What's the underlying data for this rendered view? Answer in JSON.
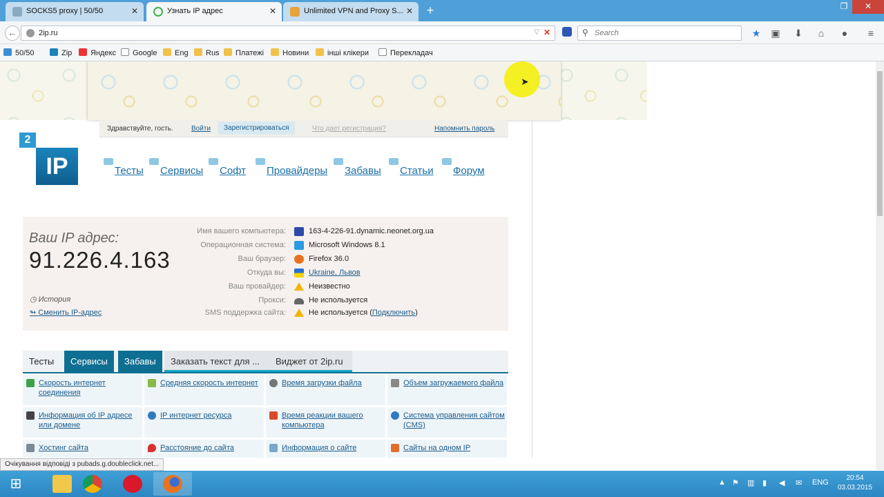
{
  "browser": {
    "tabs": [
      {
        "label": "SOCKS5 proxy | 50/50",
        "active": false
      },
      {
        "label": "Узнать IP адрес",
        "active": true
      },
      {
        "label": "Unlimited VPN and Proxy S...",
        "active": false
      }
    ],
    "new_tab": "+",
    "url": "2ip.ru",
    "search_placeholder": "Search",
    "window_controls": {
      "restore": "❐",
      "close": "✕"
    }
  },
  "bookmarks": [
    {
      "label": "50/50",
      "icon": "page-icon"
    },
    {
      "label": "Zip",
      "icon": "zip-icon"
    },
    {
      "label": "Яндекс",
      "icon": "yandex-icon"
    },
    {
      "label": "Google",
      "icon": "page-icon"
    },
    {
      "label": "Eng",
      "icon": "folder-icon"
    },
    {
      "label": "Rus",
      "icon": "folder-icon"
    },
    {
      "label": "Платежі",
      "icon": "folder-icon"
    },
    {
      "label": "Новини",
      "icon": "folder-icon"
    },
    {
      "label": "інші клікери",
      "icon": "folder-icon"
    },
    {
      "label": "Перекладач",
      "icon": "page-icon"
    }
  ],
  "site": {
    "login_bar": {
      "greeting": "Здравствуйте, гость.",
      "login": "Войти",
      "register": "Зарегистрироваться",
      "why_register": "Что дает регистрация?",
      "remind_password": "Напомнить пароль"
    },
    "logo": {
      "number": "2",
      "text": "IP"
    },
    "menu": [
      "Тесты",
      "Сервисы",
      "Софт",
      "Провайдеры",
      "Забавы",
      "Статьи",
      "Форум"
    ],
    "ip_box": {
      "label": "Ваш IP адрес:",
      "ip": "91.226.4.163",
      "history": "История",
      "change_ip": "Сменить IP-адрес"
    },
    "info_rows": [
      {
        "key": "Имя вашего компьютера:",
        "value": "163-4-226-91.dynamic.neonet.org.ua",
        "icon": "computer-icon",
        "link": false
      },
      {
        "key": "Операционная система:",
        "value": "Microsoft Windows 8.1",
        "icon": "windows-icon",
        "link": false
      },
      {
        "key": "Ваш браузер:",
        "value": "Firefox 36.0",
        "icon": "firefox-icon",
        "link": false
      },
      {
        "key": "Откуда вы:",
        "value": "Ukraine, Львов",
        "icon": "flag-icon",
        "link": true
      },
      {
        "key": "Ваш провайдер:",
        "value": "Неизвестно",
        "icon": "warning-icon",
        "link": false
      },
      {
        "key": "Прокси:",
        "value": "Не используется",
        "icon": "car-icon",
        "link": false
      },
      {
        "key": "SMS поддержка сайта:",
        "value": "Не используется (",
        "value_link": "Подключить",
        "value_end": ")",
        "icon": "warning-icon",
        "link": false
      }
    ],
    "content_tabs": [
      {
        "label": "Тесты",
        "style": "plain"
      },
      {
        "label": "Сервисы",
        "style": "dark"
      },
      {
        "label": "Забавы",
        "style": "dark"
      },
      {
        "label": "Заказать текст для ...",
        "style": "grey"
      },
      {
        "label": "Виджет от 2ip.ru",
        "style": "grey"
      }
    ],
    "services": [
      [
        "Скорость интернет соединения",
        "Средняя скорость интернет",
        "Время загрузки файла",
        "Объем загружаемого файла"
      ],
      [
        "Информация об IP адресе или домене",
        "IP интернет ресурса",
        "Время реакции вашего компьютера",
        "Система управления сайтом (CMS)"
      ],
      [
        "Хостинг сайта",
        "Расстояние до сайта",
        "Информация о сайте",
        "Сайты на одном IP"
      ]
    ]
  },
  "status_bar": "Очікування відповіді з pubads.g.doubleclick.net...",
  "taskbar": {
    "apps": [
      "file-explorer-icon",
      "chrome-icon",
      "opera-icon",
      "firefox-icon"
    ],
    "language": "ENG",
    "time": "20:54",
    "date": "03.03.2015"
  },
  "colors": {
    "titlebar": "#4fa0d8",
    "accent": "#0f6f92",
    "link": "#1a5b8a",
    "taskbar": "#2d86c2"
  }
}
